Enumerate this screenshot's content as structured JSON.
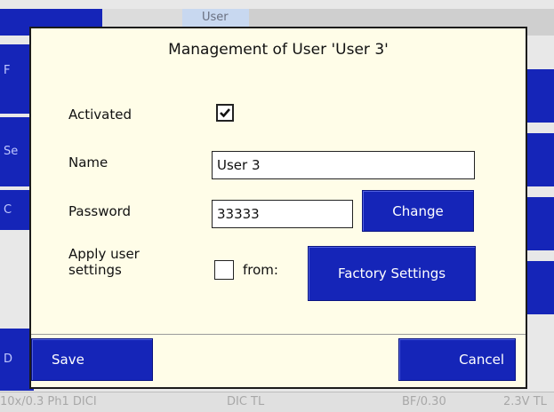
{
  "background": {
    "tab_label": "User",
    "left_buttons": [
      "F",
      "Se",
      "C",
      "D"
    ],
    "status_left": "10x/0.3 Ph1 DICI",
    "status_mid": "DIC TL",
    "status_right1": "BF/0.30",
    "status_right2": "2.3V TL"
  },
  "dialog": {
    "title": "Management of User 'User 3'",
    "activated_label": "Activated",
    "activated_checked": true,
    "name_label": "Name",
    "name_value": "User 3",
    "password_label": "Password",
    "password_value": "33333",
    "change_label": "Change",
    "apply_label_line1": "Apply user",
    "apply_label_line2": "settings",
    "apply_checked": false,
    "from_label": "from:",
    "factory_label": "Factory Settings",
    "save_label": "Save",
    "cancel_label": "Cancel"
  },
  "colors": {
    "accent_blue": "#1525b8",
    "dialog_bg": "#fffde8"
  }
}
